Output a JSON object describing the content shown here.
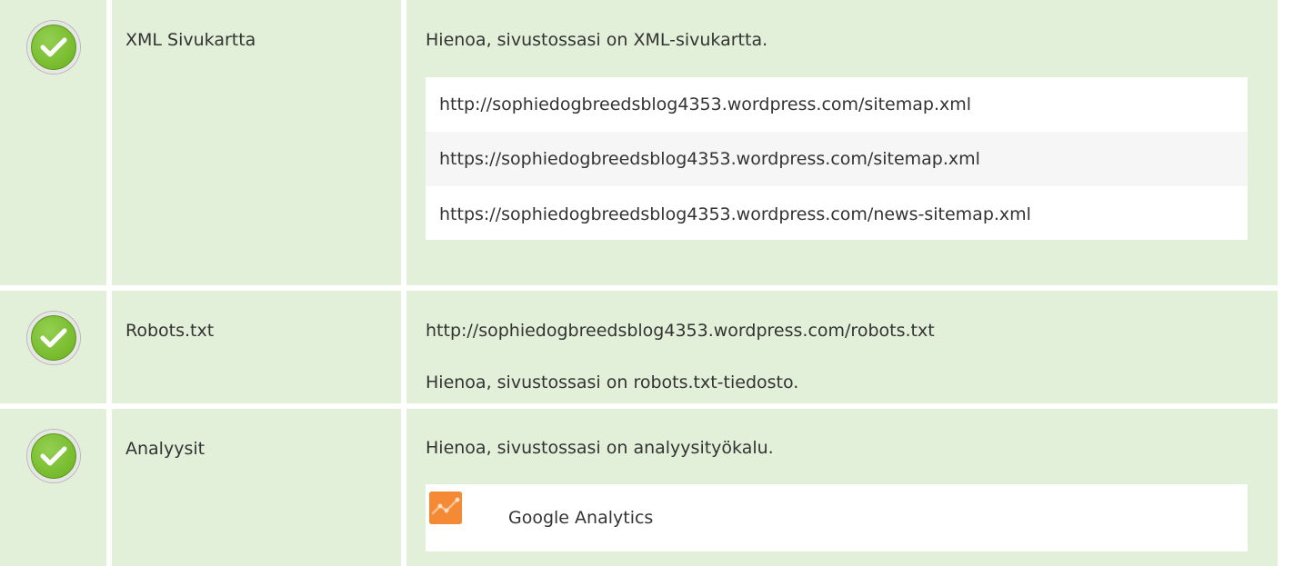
{
  "checks": [
    {
      "label": "XML Sivukartta",
      "message": "Hienoa, sivustossasi on XML-sivukartta.",
      "urls": [
        "http://sophiedogbreedsblog4353.wordpress.com/sitemap.xml",
        "https://sophiedogbreedsblog4353.wordpress.com/sitemap.xml",
        "https://sophiedogbreedsblog4353.wordpress.com/news-sitemap.xml"
      ]
    },
    {
      "label": "Robots.txt",
      "url": "http://sophiedogbreedsblog4353.wordpress.com/robots.txt",
      "message": "Hienoa, sivustossasi on robots.txt-tiedosto."
    },
    {
      "label": "Analyysit",
      "message": "Hienoa, sivustossasi on analyysityökalu.",
      "tools": [
        {
          "name": "Google Analytics",
          "icon": "google-analytics-icon"
        }
      ]
    }
  ],
  "colors": {
    "row_background": "#e3f0d9",
    "check_green": "#7cbf33",
    "analytics_orange": "#f48936",
    "text": "#333333"
  },
  "icons": {
    "status": "check-circle-icon"
  }
}
